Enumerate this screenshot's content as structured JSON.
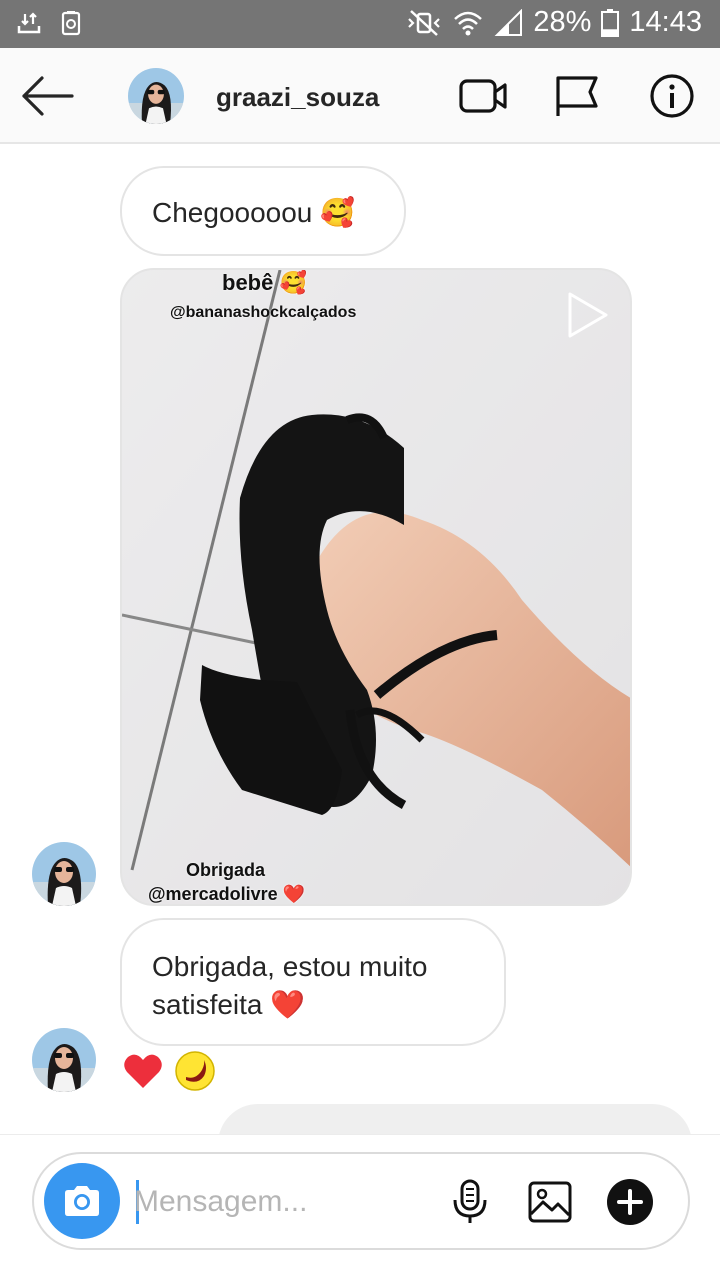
{
  "status_bar": {
    "battery_percent": "28%",
    "time": "14:43",
    "battery_level": 0.28,
    "icons": [
      "download-icon",
      "recycle-icon",
      "mute-vibrate-icon",
      "wifi-icon",
      "signal-icon",
      "battery-icon"
    ]
  },
  "header": {
    "username": "graazi_souza",
    "icons": [
      "back-arrow-icon",
      "video-call-icon",
      "flag-icon",
      "info-icon"
    ]
  },
  "messages": {
    "first": "Chegooooou 🥰",
    "media": {
      "caption_top": "bebê 🥰",
      "caption_handle": "@bananashockcalçados",
      "caption_bottom_1": "Obrigada",
      "caption_bottom_2": "@mercadolivre ❤️"
    },
    "second_line_1": "Obrigada, estou muito",
    "second_line_2": "satisfeita ❤️",
    "reactions": [
      "heart-emoji",
      "banana-emoji"
    ]
  },
  "composer": {
    "placeholder": "Mensagem...",
    "icons": [
      "camera-icon",
      "microphone-icon",
      "gallery-icon",
      "plus-icon"
    ]
  },
  "colors": {
    "status_bar": "#757575",
    "accent": "#3897f0",
    "bubble_border": "#e4e4e4",
    "text": "#262626",
    "heart": "#ed2f3c"
  }
}
